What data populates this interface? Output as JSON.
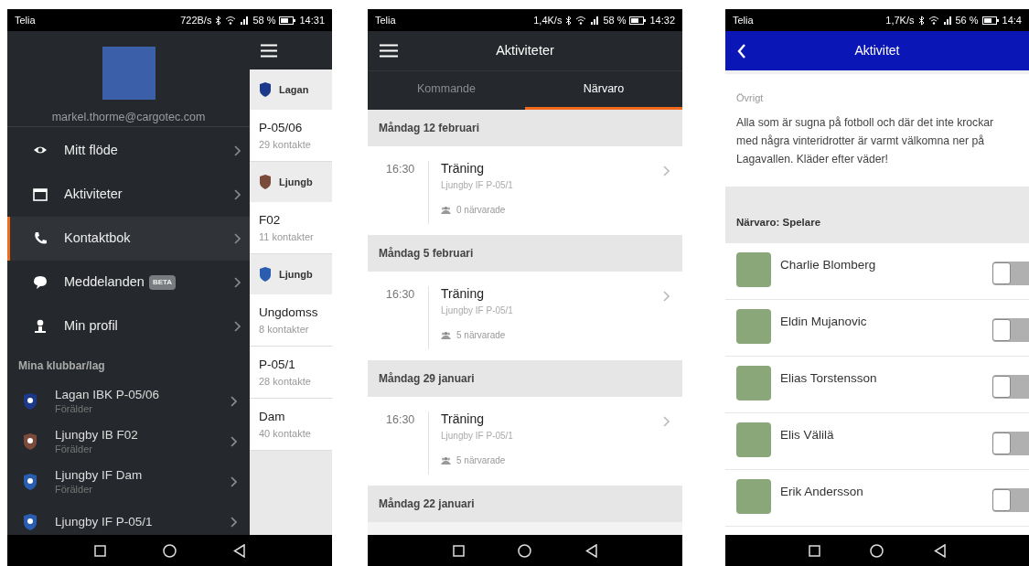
{
  "drawer_screen": {
    "status_bar": {
      "carrier": "Telia",
      "speed": "722B/s",
      "battery": "58 %",
      "time": "14:31"
    },
    "email": "markel.thorme@cargotec.com",
    "menu": [
      {
        "label": "Mitt flöde",
        "selected": false
      },
      {
        "label": "Aktiviteter",
        "selected": false
      },
      {
        "label": "Kontaktbok",
        "selected": true
      },
      {
        "label": "Meddelanden",
        "badge": "BETA",
        "selected": false
      },
      {
        "label": "Min profil",
        "selected": false
      }
    ],
    "clubs_heading": "Mina klubbar/lag",
    "clubs": [
      {
        "name": "Lagan IBK P-05/06",
        "role": "Förälder"
      },
      {
        "name": "Ljungby IB F02",
        "role": "Förälder"
      },
      {
        "name": "Ljungby IF Dam",
        "role": "Förälder"
      },
      {
        "name": "Ljungby IF P-05/1"
      }
    ],
    "contacts": [
      {
        "club": "Lagan",
        "groups": [
          {
            "name": "P-05/06",
            "count": "29 kontakte"
          }
        ]
      },
      {
        "club": "Ljungb",
        "groups": [
          {
            "name": "F02",
            "count": "11 kontakter"
          }
        ]
      },
      {
        "club": "Ljungb",
        "groups": [
          {
            "name": "Ungdomss",
            "count": "8 kontakter"
          },
          {
            "name": "P-05/1",
            "count": "28 kontakte"
          },
          {
            "name": "Dam",
            "count": "40 kontakte"
          }
        ]
      }
    ]
  },
  "activities_screen": {
    "status_bar": {
      "carrier": "Telia",
      "speed": "1,4K/s",
      "battery": "58 %",
      "time": "14:32"
    },
    "title": "Aktiviteter",
    "tabs": [
      {
        "label": "Kommande",
        "selected": false
      },
      {
        "label": "Närvaro",
        "selected": true
      }
    ],
    "days": [
      {
        "date": "Måndag 12 februari",
        "events": [
          {
            "time": "16:30",
            "title": "Träning",
            "team": "Ljungby IF P-05/1",
            "attendance": "0 närvarade"
          }
        ]
      },
      {
        "date": "Måndag 5 februari",
        "events": [
          {
            "time": "16:30",
            "title": "Träning",
            "team": "Ljungby IF P-05/1",
            "attendance": "5 närvarade"
          }
        ]
      },
      {
        "date": "Måndag 29 januari",
        "events": [
          {
            "time": "16:30",
            "title": "Träning",
            "team": "Ljungby IF P-05/1",
            "attendance": "5 närvarade"
          }
        ]
      },
      {
        "date": "Måndag 22 januari"
      }
    ]
  },
  "activity_screen": {
    "status_bar": {
      "carrier": "Telia",
      "speed": "1,7K/s",
      "battery": "56 %",
      "time": "14:4"
    },
    "title": "Aktivitet",
    "other_label": "Övrigt",
    "other_text": "Alla som är sugna på fotboll och där det inte krockar med några vinteridrotter är varmt välkomna ner på Lagavallen. Kläder efter väder!",
    "attendance_heading": "Närvaro: Spelare",
    "players": [
      {
        "name": "Charlie Blomberg",
        "present": false
      },
      {
        "name": "Eldin Mujanovic",
        "present": false
      },
      {
        "name": "Elias Torstensson",
        "present": false
      },
      {
        "name": "Elis Välilä",
        "present": false
      },
      {
        "name": "Erik Andersson",
        "present": false
      }
    ]
  }
}
